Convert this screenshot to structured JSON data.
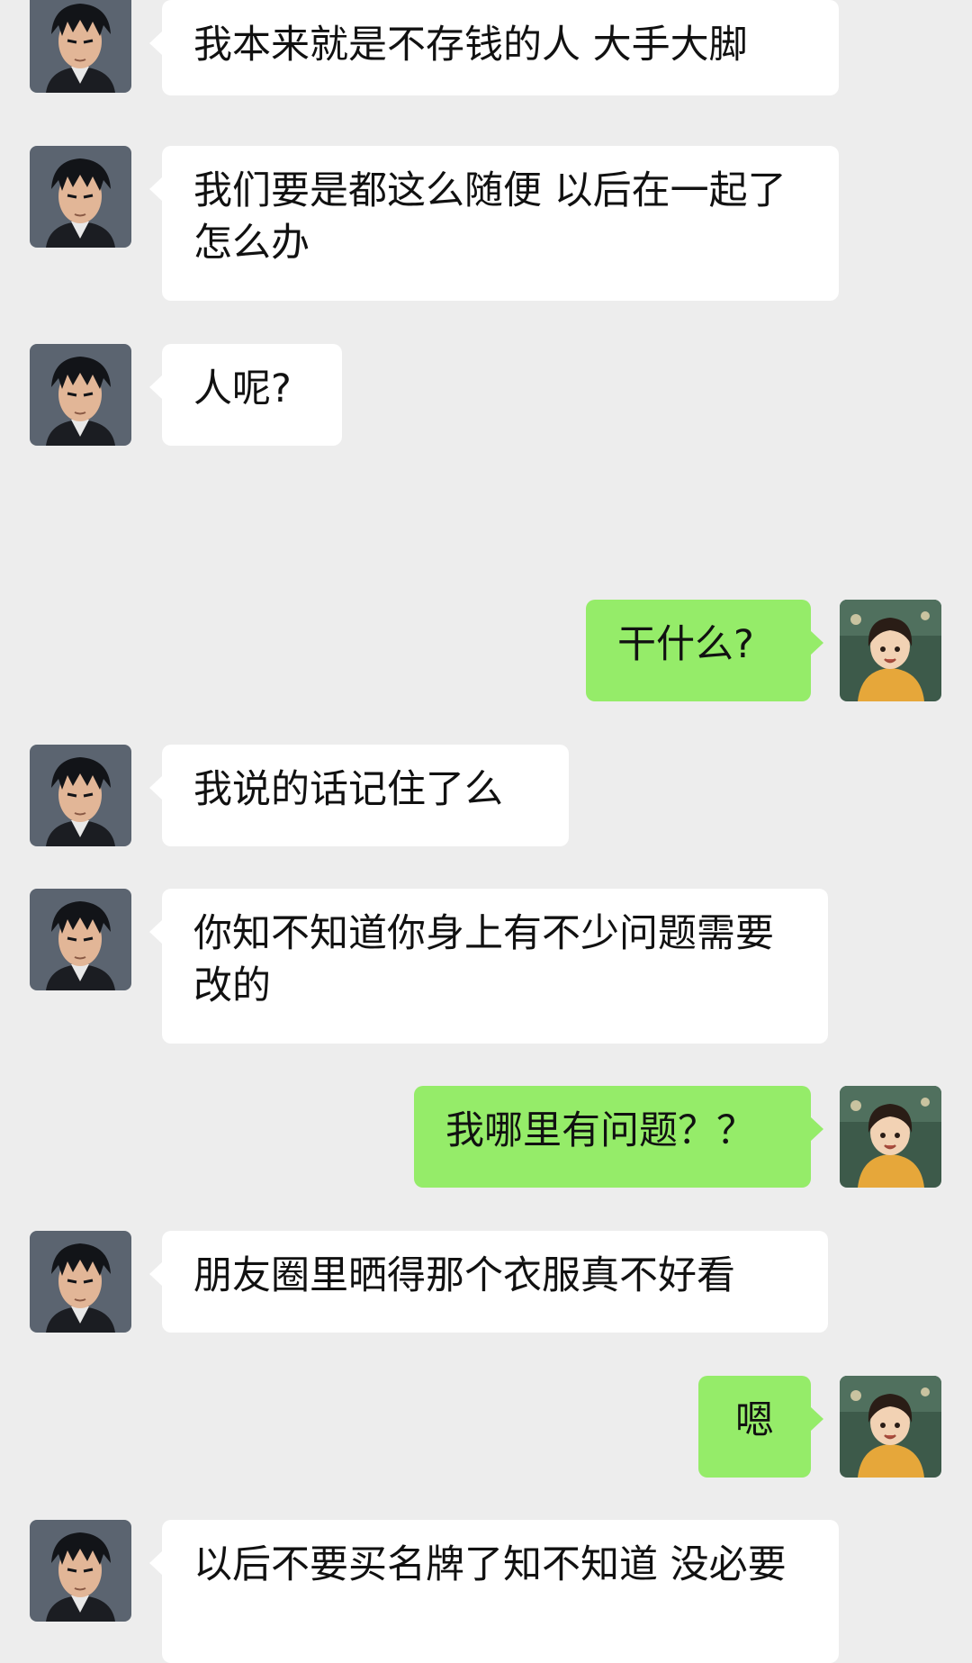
{
  "colors": {
    "background": "#ededed",
    "incoming_bubble": "#ffffff",
    "outgoing_bubble": "#95ec69",
    "text": "#111111"
  },
  "contact_avatar_icon": "anime-man-avatar",
  "self_avatar_icon": "anime-girl-avatar",
  "messages": [
    {
      "side": "in",
      "text": "我本来就是不存钱的人 大手大脚"
    },
    {
      "side": "in",
      "text": "我们要是都这么随便 以后在一起了怎么办"
    },
    {
      "side": "in",
      "text": "人呢?"
    },
    {
      "side": "out",
      "text": "干什么?"
    },
    {
      "side": "in",
      "text": "我说的话记住了么"
    },
    {
      "side": "in",
      "text": "你知不知道你身上有不少问题需要改的"
    },
    {
      "side": "out",
      "text": "我哪里有问题？？"
    },
    {
      "side": "in",
      "text": "朋友圈里晒得那个衣服真不好看"
    },
    {
      "side": "out",
      "text": "嗯"
    },
    {
      "side": "in",
      "text": "以后不要买名牌了知不知道 没必要"
    }
  ]
}
